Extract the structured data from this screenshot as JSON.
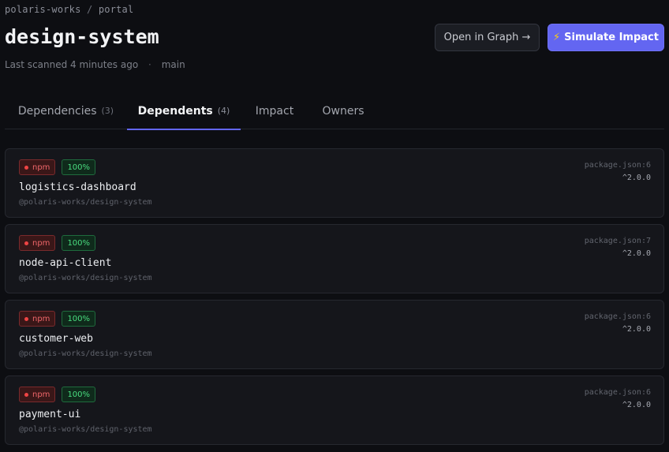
{
  "breadcrumb": {
    "org": "polaris-works",
    "separator": "/",
    "project": "portal"
  },
  "header": {
    "title": "design-system",
    "scanned": "Last scanned 4 minutes ago",
    "dot": "·",
    "branch": "main"
  },
  "actions": {
    "open_graph": "Open in Graph →",
    "simulate_icon": "⚡",
    "simulate": "Simulate Impact"
  },
  "tabs": [
    {
      "label": "Dependencies",
      "count": "(3)"
    },
    {
      "label": "Dependents",
      "count": "(4)",
      "active": true
    },
    {
      "label": "Impact"
    },
    {
      "label": "Owners"
    }
  ],
  "dependents": [
    {
      "ecosystem": "npm",
      "coverage": "100%",
      "name": "logistics-dashboard",
      "package": "@polaris-works/design-system",
      "file": "package.json:6",
      "version": "^2.0.0"
    },
    {
      "ecosystem": "npm",
      "coverage": "100%",
      "name": "node-api-client",
      "package": "@polaris-works/design-system",
      "file": "package.json:7",
      "version": "^2.0.0"
    },
    {
      "ecosystem": "npm",
      "coverage": "100%",
      "name": "customer-web",
      "package": "@polaris-works/design-system",
      "file": "package.json:6",
      "version": "^2.0.0"
    },
    {
      "ecosystem": "npm",
      "coverage": "100%",
      "name": "payment-ui",
      "package": "@polaris-works/design-system",
      "file": "package.json:6",
      "version": "^2.0.0"
    }
  ],
  "colors": {
    "accent": "#6366f1",
    "npm_badge": "#ef4444",
    "coverage_badge": "#4ade80",
    "background": "#0d0e12"
  }
}
